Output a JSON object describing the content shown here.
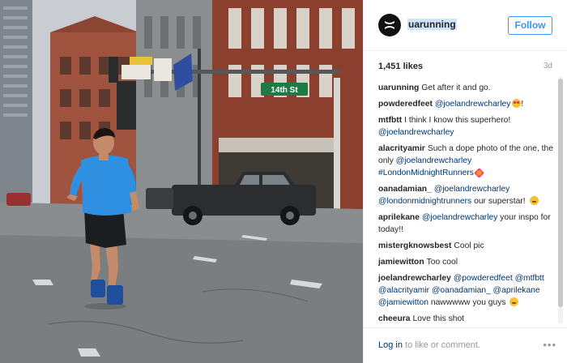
{
  "post": {
    "username": "uarunning",
    "follow_label": "Follow",
    "likes": "1,451 likes",
    "time_ago": "3d",
    "scene_sign": "14th St"
  },
  "comments": [
    {
      "user": "uarunning",
      "text": "Get after it and go."
    },
    {
      "user": "powderedfeet",
      "mention": "@joelandrewcharley",
      "emoji": "heart-eyes",
      "tail": "!"
    },
    {
      "user": "mtfbtt",
      "text": "I think I know this superhero!",
      "mention": "@joelandrewcharley"
    },
    {
      "user": "alacrityamir",
      "text": "Such a dope photo of the one, the only",
      "mention": "@joelandrewcharley",
      "mention2": "#LondonMidnightRunners",
      "emoji": "spark"
    },
    {
      "user": "oanadamian_",
      "mention": "@joelandrewcharley",
      "mention2": "@londonmidnightrunners",
      "text2": "our superstar!",
      "emoji": "smile"
    },
    {
      "user": "aprilekane",
      "mention": "@joelandrewcharley",
      "text2": "your inspo for today!!"
    },
    {
      "user": "mistergknowsbest",
      "text": "Cool pic"
    },
    {
      "user": "jamiewitton",
      "text": "Too cool"
    },
    {
      "user": "joelandrewcharley",
      "mention": "@powderedfeet @mtfbtt @alacrityamir @oanadamian_ @aprilekane @jamiewitton",
      "text2": "nawwwww you guys",
      "emoji": "smile"
    },
    {
      "user": "cheeura",
      "text": "Love this shot"
    }
  ],
  "footer": {
    "login_link": "Log in",
    "login_text": "to like or comment.",
    "more_label": "•••"
  },
  "colors": {
    "follow_blue": "#3897f0",
    "mention_blue": "#003569",
    "shirt_blue": "#2f8fe0"
  }
}
